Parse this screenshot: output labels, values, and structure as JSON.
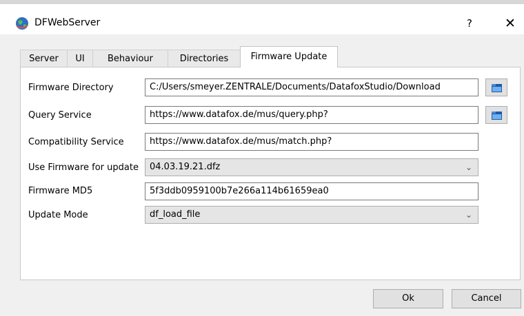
{
  "window": {
    "title": "DFWebServer",
    "help_label": "?",
    "close_label": "✕",
    "app_icon": "globe-icon"
  },
  "tabs": [
    {
      "label": "Server"
    },
    {
      "label": "UI"
    },
    {
      "label": "Behaviour"
    },
    {
      "label": "Directories"
    },
    {
      "label": "Firmware Update",
      "active": true
    }
  ],
  "form": {
    "firmware_directory": {
      "label": "Firmware Directory",
      "value": "C:/Users/smeyer.ZENTRALE/Documents/DatafoxStudio/Download"
    },
    "query_service": {
      "label": "Query Service",
      "value": "https://www.datafox.de/mus/query.php?"
    },
    "compatibility_service": {
      "label": "Compatibility Service",
      "value": "https://www.datafox.de/mus/match.php?"
    },
    "use_firmware": {
      "label": "Use Firmware for update",
      "value": "04.03.19.21.dfz"
    },
    "firmware_md5": {
      "label": "Firmware MD5",
      "value": "5f3ddb0959100b7e266a114b61659ea0"
    },
    "update_mode": {
      "label": "Update Mode",
      "value": "df_load_file"
    }
  },
  "buttons": {
    "ok": "Ok",
    "cancel": "Cancel"
  },
  "icons": {
    "browse": "folder-icon",
    "dropdown": "chevron-down-icon"
  }
}
